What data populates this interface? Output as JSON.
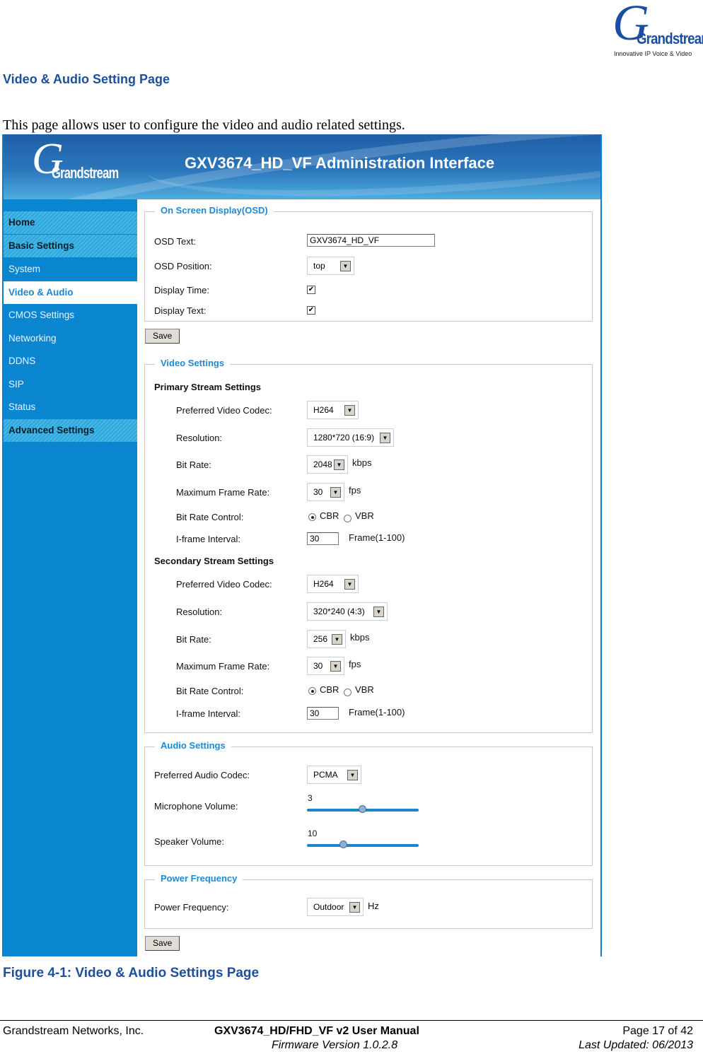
{
  "header_logo": {
    "brand": "Grandstream",
    "tagline": "Innovative IP Voice & Video"
  },
  "section_title": "Video & Audio Setting Page",
  "intro": "This page allows user to configure the video and audio related settings.",
  "app": {
    "brand": "Grandstream",
    "title": "GXV3674_HD_VF Administration Interface",
    "accent_color": "#0a86d0",
    "sidebar": [
      {
        "label": "Home",
        "type": "header"
      },
      {
        "label": "Basic Settings",
        "type": "header"
      },
      {
        "label": "System",
        "type": "item"
      },
      {
        "label": "Video & Audio",
        "type": "active"
      },
      {
        "label": "CMOS Settings",
        "type": "item"
      },
      {
        "label": "Networking",
        "type": "item"
      },
      {
        "label": "DDNS",
        "type": "item"
      },
      {
        "label": "SIP",
        "type": "item"
      },
      {
        "label": "Status",
        "type": "item"
      },
      {
        "label": "Advanced Settings",
        "type": "header"
      }
    ],
    "osd": {
      "legend": "On Screen Display(OSD)",
      "text_label": "OSD Text:",
      "text_value": "GXV3674_HD_VF",
      "position_label": "OSD Position:",
      "position_value": "top",
      "display_time_label": "Display Time:",
      "display_time_checked": true,
      "display_text_label": "Display Text:",
      "display_text_checked": true,
      "check_glyph": "✔"
    },
    "save_label": "Save",
    "video": {
      "legend": "Video Settings",
      "primary": {
        "title": "Primary Stream Settings",
        "codec_label": "Preferred Video Codec:",
        "codec": "H264",
        "resolution_label": "Resolution:",
        "resolution": "1280*720 (16:9)",
        "bitrate_label": "Bit Rate:",
        "bitrate": "2048",
        "bitrate_unit": "kbps",
        "framerate_label": "Maximum Frame Rate:",
        "framerate": "30",
        "framerate_unit": "fps",
        "control_label": "Bit Rate Control:",
        "cbr": "CBR",
        "vbr": "VBR",
        "selected": "CBR",
        "iframe_label": "I-frame Interval:",
        "iframe": "30",
        "iframe_unit": "Frame(1-100)"
      },
      "secondary": {
        "title": "Secondary Stream Settings",
        "codec_label": "Preferred Video Codec:",
        "codec": "H264",
        "resolution_label": "Resolution:",
        "resolution": "320*240 (4:3)",
        "bitrate_label": "Bit Rate:",
        "bitrate": "256",
        "bitrate_unit": "kbps",
        "framerate_label": "Maximum Frame Rate:",
        "framerate": "30",
        "framerate_unit": "fps",
        "control_label": "Bit Rate Control:",
        "cbr": "CBR",
        "vbr": "VBR",
        "selected": "CBR",
        "iframe_label": "I-frame Interval:",
        "iframe": "30",
        "iframe_unit": "Frame(1-100)"
      }
    },
    "audio": {
      "legend": "Audio Settings",
      "codec_label": "Preferred Audio Codec:",
      "codec": "PCMA",
      "mic_label": "Microphone Volume:",
      "mic_value": "3",
      "mic_fraction": 0.5,
      "speaker_label": "Speaker Volume:",
      "speaker_value": "10",
      "speaker_fraction": 0.33
    },
    "power": {
      "legend": "Power Frequency",
      "label": "Power Frequency:",
      "value": "Outdoor",
      "unit": "Hz"
    }
  },
  "caption": "Figure 4-1:  Video & Audio Settings Page",
  "footer": {
    "company": "Grandstream Networks, Inc.",
    "manual": "GXV3674_HD/FHD_VF v2 User Manual",
    "firmware": "Firmware Version 1.0.2.8",
    "page": "Page 17 of 42",
    "updated": "Last Updated: 06/2013"
  }
}
